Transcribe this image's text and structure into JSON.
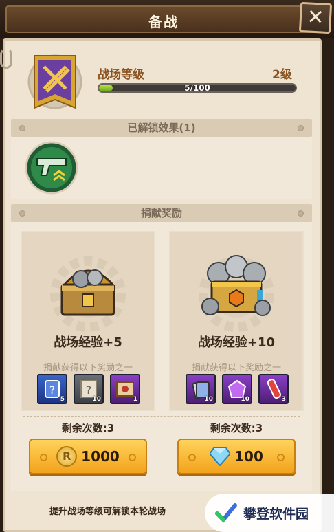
{
  "header": {
    "title": "备战"
  },
  "level": {
    "label": "战场等级",
    "value": "2级",
    "progress_text": "5/100",
    "progress_fraction": 0.05
  },
  "unlocked": {
    "title": "已解锁效果(1)",
    "effects": [
      "pistol-upgrade-icon"
    ]
  },
  "donation": {
    "title": "捐献奖励",
    "cards": [
      {
        "exp_label": "战场经验+5",
        "sub_label": "捐献获得以下奖励之一",
        "rewards": [
          {
            "icon": "question-card-icon",
            "count": "5"
          },
          {
            "icon": "question-scroll-icon",
            "count": "10"
          },
          {
            "icon": "treasure-map-icon",
            "count": "1"
          }
        ],
        "remaining": "剩余次数:3",
        "price": "1000",
        "currency_icon": "gold-coin-icon"
      },
      {
        "exp_label": "战场经验+10",
        "sub_label": "捐献获得以下奖励之一",
        "rewards": [
          {
            "icon": "card-pack-icon",
            "count": "10"
          },
          {
            "icon": "purple-gem-icon",
            "count": "10"
          },
          {
            "icon": "potion-tube-icon",
            "count": "3"
          }
        ],
        "remaining": "剩余次数:3",
        "price": "100",
        "currency_icon": "diamond-icon"
      }
    ]
  },
  "footer": {
    "hint": "提升战场等级可解锁本轮战场"
  },
  "watermark": {
    "text": "攀登软件园"
  },
  "colors": {
    "accent_gold": "#f3a31c",
    "progress_green": "#8cc63f",
    "title_brown": "#8a5320"
  }
}
